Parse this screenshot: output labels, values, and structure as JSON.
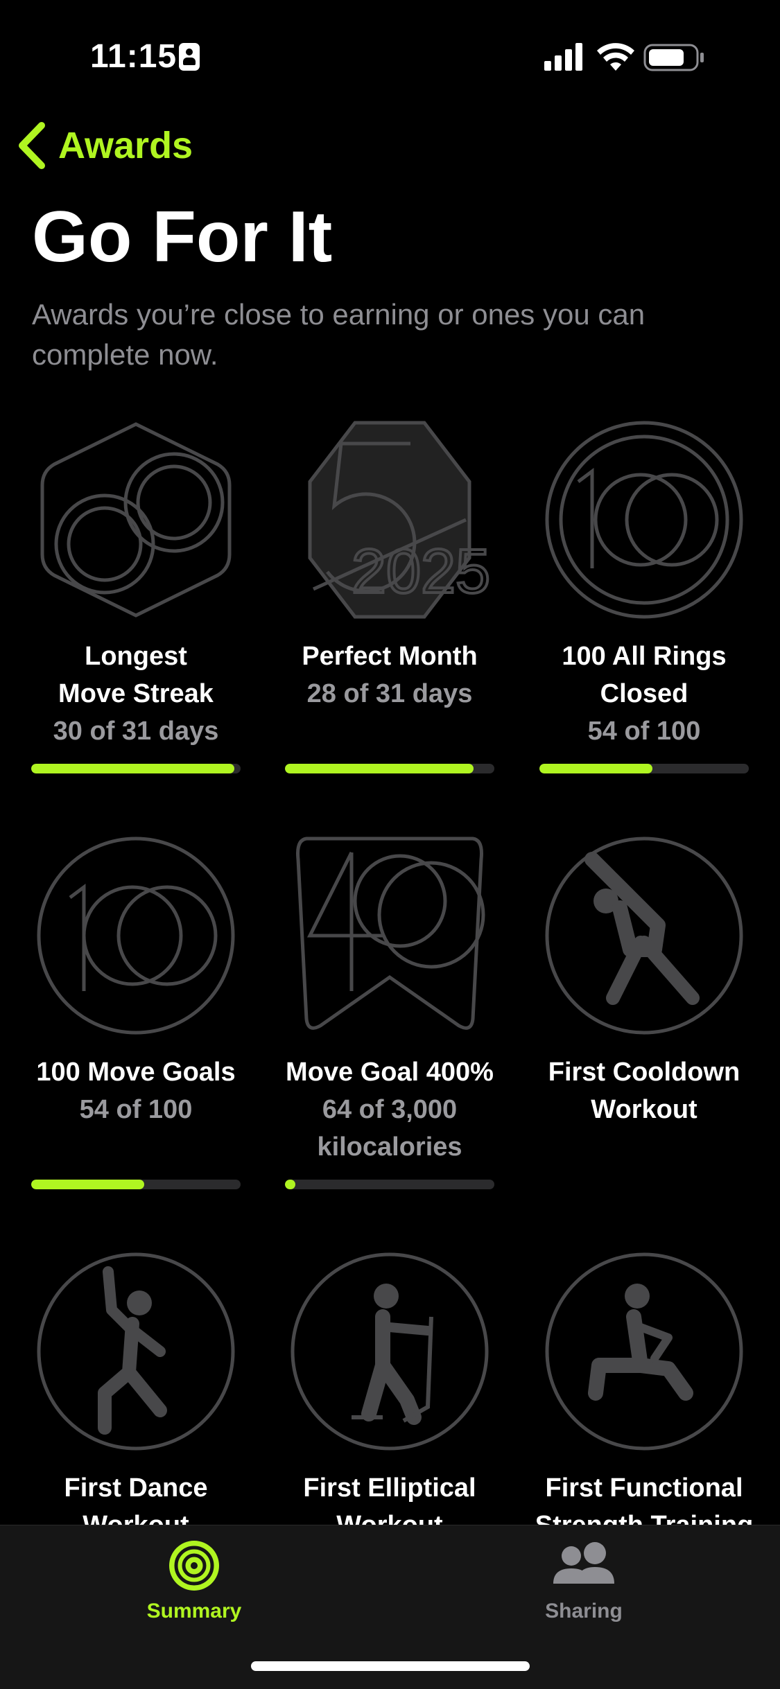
{
  "status": {
    "time": "11:15"
  },
  "nav": {
    "back_label": "Awards"
  },
  "page": {
    "title": "Go For It",
    "subtitle": "Awards you’re close to earning or ones you can complete now."
  },
  "awards": [
    {
      "name": "Longest\nMove Streak",
      "progress": "30 of 31 days",
      "fraction": 0.97,
      "icon": "hexagon-rings-badge"
    },
    {
      "name": "Perfect Month",
      "progress": "28 of 31 days",
      "fraction": 0.9,
      "icon": "hexagon-5-2025-badge"
    },
    {
      "name": "100 All Rings\nClosed",
      "progress": "54 of 100",
      "fraction": 0.54,
      "icon": "circle-100-badge"
    },
    {
      "name": "100 Move Goals",
      "progress": "54 of 100",
      "fraction": 0.54,
      "icon": "circle-100-badge"
    },
    {
      "name": "Move Goal 400%",
      "progress": "64 of 3,000\nkilocalories",
      "fraction": 0.05,
      "icon": "square-400-badge"
    },
    {
      "name": "First Cooldown\nWorkout",
      "progress": "",
      "fraction": null,
      "icon": "cooldown-figure-badge"
    },
    {
      "name": "First Dance\nWorkout",
      "progress": "",
      "fraction": null,
      "icon": "dance-figure-badge"
    },
    {
      "name": "First Elliptical\nWorkout",
      "progress": "",
      "fraction": null,
      "icon": "elliptical-figure-badge"
    },
    {
      "name": "First Functional\nStrength Training",
      "progress": "",
      "fraction": null,
      "icon": "strength-figure-badge"
    }
  ],
  "tabs": [
    {
      "label": "Summary",
      "icon": "activity-rings-icon",
      "active": true
    },
    {
      "label": "Sharing",
      "icon": "people-icon",
      "active": false
    }
  ],
  "colors": {
    "accent": "#b0f521",
    "badge_stroke": "#48484a",
    "muted": "#8e8e93"
  }
}
